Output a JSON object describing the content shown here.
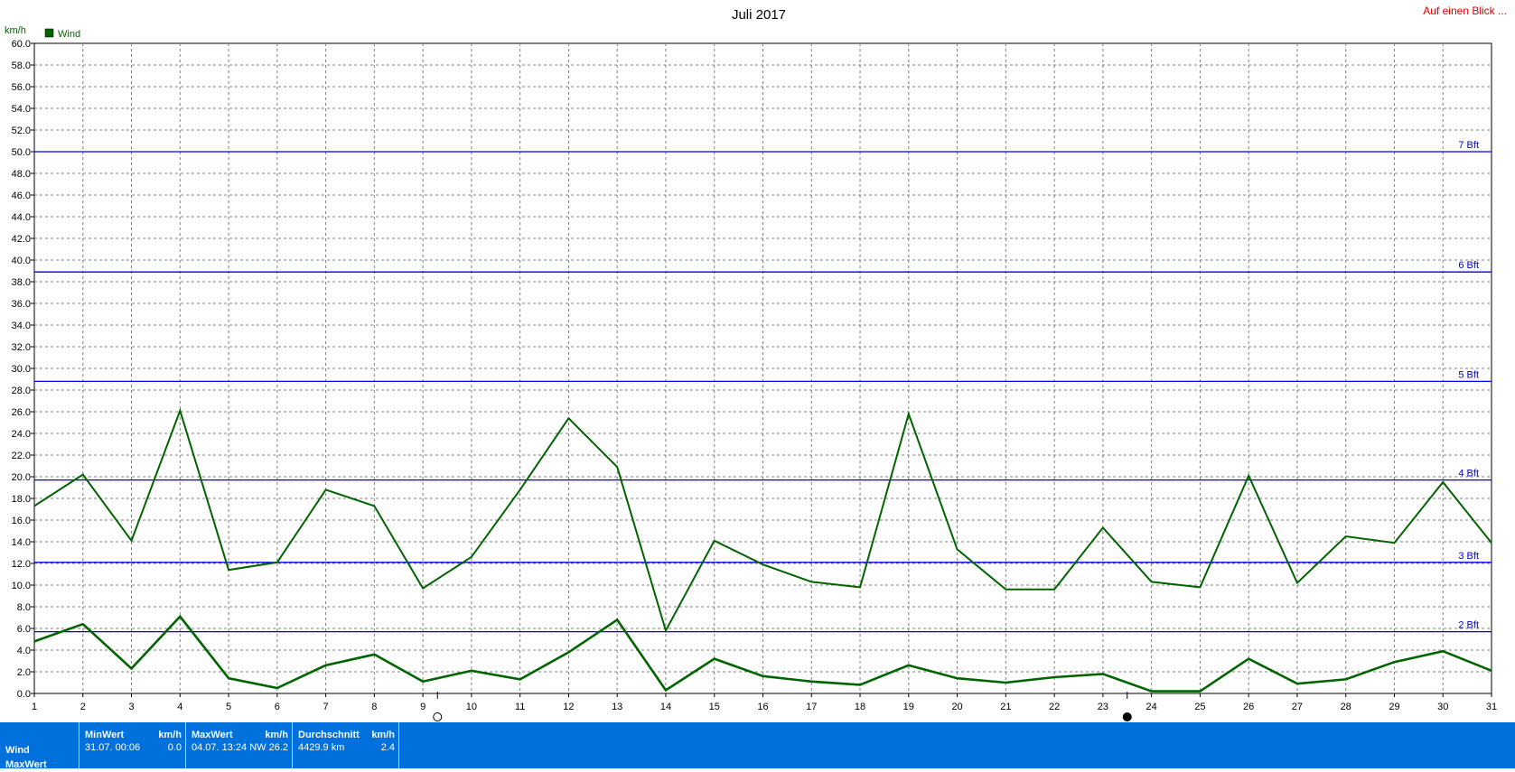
{
  "chart_data": {
    "type": "line",
    "title": "Juli 2017",
    "ylabel": "km/h",
    "legend": [
      "Wind"
    ],
    "legend_placement": "top-left",
    "grid": true,
    "ylim": [
      0,
      60
    ],
    "yticks": [
      "0.0",
      "2.0",
      "4.0",
      "6.0",
      "8.0",
      "10.0",
      "12.0",
      "14.0",
      "16.0",
      "18.0",
      "20.0",
      "22.0",
      "24.0",
      "26.0",
      "28.0",
      "30.0",
      "32.0",
      "34.0",
      "36.0",
      "38.0",
      "40.0",
      "42.0",
      "44.0",
      "46.0",
      "48.0",
      "50.0",
      "52.0",
      "54.0",
      "56.0",
      "58.0",
      "60.0"
    ],
    "x": [
      1,
      2,
      3,
      4,
      5,
      6,
      7,
      8,
      9,
      10,
      11,
      12,
      13,
      14,
      15,
      16,
      17,
      18,
      19,
      20,
      21,
      22,
      23,
      24,
      25,
      26,
      27,
      28,
      29,
      30,
      31
    ],
    "series": [
      {
        "name": "Wind",
        "color": "#006400",
        "values": [
          17.3,
          20.2,
          14.1,
          26.1,
          11.4,
          12.1,
          18.8,
          17.3,
          9.7,
          12.6,
          18.8,
          25.4,
          20.9,
          5.8,
          14.1,
          11.9,
          10.3,
          9.8,
          25.8,
          13.3,
          9.6,
          9.6,
          15.3,
          10.3,
          9.8,
          20.1,
          10.2,
          14.5,
          13.9,
          19.5,
          13.9
        ]
      },
      {
        "name": "",
        "color": "#006400",
        "values": [
          4.8,
          6.4,
          2.3,
          7.1,
          1.4,
          0.5,
          2.6,
          3.6,
          1.1,
          2.1,
          1.3,
          3.8,
          6.8,
          0.3,
          3.2,
          1.6,
          1.1,
          0.8,
          2.6,
          1.4,
          1.0,
          1.5,
          1.8,
          0.2,
          0.2,
          3.2,
          0.9,
          1.3,
          2.9,
          3.9,
          2.1
        ]
      }
    ],
    "reference_lines": [
      {
        "label": "2 Bft",
        "value": 5.7
      },
      {
        "label": "3 Bft",
        "value": 12.1
      },
      {
        "label": "4 Bft",
        "value": 19.7
      },
      {
        "label": "5 Bft",
        "value": 28.8
      },
      {
        "label": "6 Bft",
        "value": 38.9
      },
      {
        "label": "7 Bft",
        "value": 50.0
      }
    ],
    "reference_color": "#0000e6",
    "annotation": "Auf einen Blick ...",
    "moon_markers": [
      {
        "x": 9.3,
        "phase": "full-moon"
      },
      {
        "x": 23.5,
        "phase": "new-moon"
      }
    ]
  },
  "stats": {
    "row_labels": [
      "Wind",
      "MaxWert"
    ],
    "min": {
      "header": "MinWert",
      "unit": "km/h",
      "when": "31.07.  00:06",
      "value": "0.0"
    },
    "max": {
      "header": "MaxWert",
      "unit": "km/h",
      "when": "04.07.  13:24",
      "dir": "NW",
      "value": "26.2"
    },
    "avg": {
      "header": "Durchschnitt",
      "unit": "km/h",
      "total": "4429.9 km",
      "value": "2.4"
    }
  }
}
